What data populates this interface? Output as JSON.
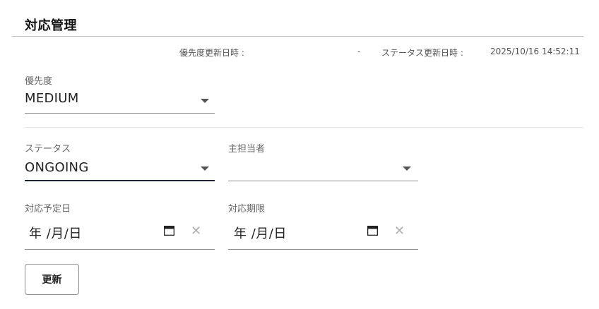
{
  "header": {
    "title": "対応管理"
  },
  "meta": {
    "priority_updated_label": "優先度更新日時 :",
    "priority_updated_value": "-",
    "status_updated_label": "ステータス更新日時 :",
    "status_updated_value": "2025/10/16 14:52:11"
  },
  "priority": {
    "label": "優先度",
    "value": "MEDIUM"
  },
  "status": {
    "label": "ステータス",
    "value": "ONGOING"
  },
  "assignee": {
    "label": "主担当者",
    "value": ""
  },
  "planned_date": {
    "label": "対応予定日",
    "placeholder": "年 /月/日"
  },
  "deadline": {
    "label": "対応期限",
    "placeholder": "年 /月/日"
  },
  "update_button": {
    "label": "更新"
  },
  "icons": {
    "dropdown": "caret-down-icon",
    "calendar": "calendar-icon",
    "clear": "close-icon"
  },
  "colors": {
    "active_underline": "#1c2230",
    "divider": "#bdbdbd"
  }
}
